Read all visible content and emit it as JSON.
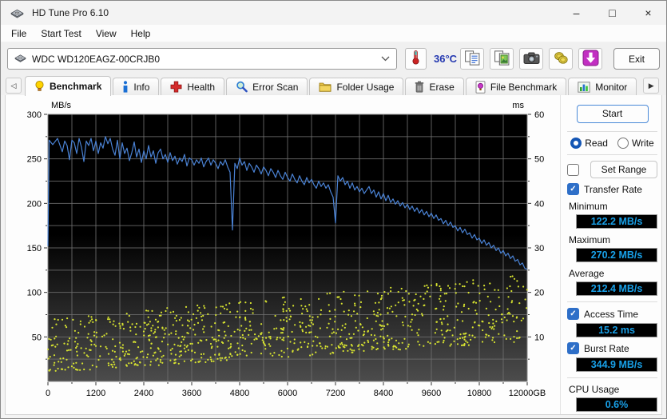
{
  "window": {
    "title": "HD Tune Pro 6.10",
    "controls": {
      "minimize": "–",
      "maximize": "□",
      "close": "×"
    }
  },
  "menu": {
    "items": [
      "File",
      "Start Test",
      "View",
      "Help"
    ]
  },
  "toolbar": {
    "device_selector": {
      "value": "WDC WD120EAGZ-00CRJB0"
    },
    "temperature": "36°C",
    "buttons": [
      {
        "name": "copy-text-icon"
      },
      {
        "name": "copy-image-icon"
      },
      {
        "name": "camera-icon"
      },
      {
        "name": "donate-icon"
      },
      {
        "name": "save-icon"
      }
    ],
    "exit_label": "Exit"
  },
  "tabs": {
    "scroll_left": "◁",
    "scroll_right": "▶",
    "items": [
      {
        "label": "Benchmark",
        "icon": "bulb-icon",
        "active": true
      },
      {
        "label": "Info",
        "icon": "info-icon",
        "active": false
      },
      {
        "label": "Health",
        "icon": "health-icon",
        "active": false
      },
      {
        "label": "Error Scan",
        "icon": "error-scan-icon",
        "active": false
      },
      {
        "label": "Folder Usage",
        "icon": "folder-icon",
        "active": false
      },
      {
        "label": "Erase",
        "icon": "erase-icon",
        "active": false
      },
      {
        "label": "File Benchmark",
        "icon": "file-benchmark-icon",
        "active": false
      },
      {
        "label": "Monitor",
        "icon": "monitor-icon",
        "active": false
      }
    ]
  },
  "side_panel": {
    "start_label": "Start",
    "read_label": "Read",
    "write_label": "Write",
    "mode": "read",
    "set_range_label": "Set Range",
    "set_range_checked": false,
    "transfer_rate_label": "Transfer Rate",
    "transfer_rate_checked": true,
    "minimum_label": "Minimum",
    "minimum_value": "122.2 MB/s",
    "maximum_label": "Maximum",
    "maximum_value": "270.2 MB/s",
    "average_label": "Average",
    "average_value": "212.4 MB/s",
    "access_time_label": "Access Time",
    "access_time_checked": true,
    "access_time_value": "15.2 ms",
    "burst_rate_label": "Burst Rate",
    "burst_rate_checked": true,
    "burst_rate_value": "344.9 MB/s",
    "cpu_usage_label": "CPU Usage",
    "cpu_usage_value": "0.6%"
  },
  "chart_data": {
    "type": "line+scatter",
    "y_left": {
      "label": "MB/s",
      "min": 0,
      "max": 300,
      "tick_step": 50,
      "grid_step": 25
    },
    "y_right": {
      "label": "ms",
      "min": 0,
      "max": 60,
      "tick_step": 10,
      "minor_step": 5
    },
    "x": {
      "min": 0,
      "max": 12000,
      "label_step": 1200,
      "grid_step": 600,
      "last_label_suffix": "GB"
    },
    "grid": true,
    "background": [
      "#000000",
      "#4c4c4c"
    ],
    "grid_color": "#6e6e6e",
    "transfer_rate_series": {
      "name": "Transfer Rate",
      "color": "#4a82d4",
      "axis": "left",
      "points": [
        [
          0,
          152
        ],
        [
          30,
          271
        ],
        [
          120,
          266
        ],
        [
          240,
          273
        ],
        [
          360,
          258
        ],
        [
          420,
          270
        ],
        [
          480,
          265
        ],
        [
          540,
          249
        ],
        [
          600,
          271
        ],
        [
          660,
          268
        ],
        [
          720,
          256
        ],
        [
          780,
          273
        ],
        [
          840,
          263
        ],
        [
          900,
          247
        ],
        [
          960,
          270
        ],
        [
          1020,
          265
        ],
        [
          1080,
          273
        ],
        [
          1140,
          259
        ],
        [
          1200,
          270
        ],
        [
          1260,
          256
        ],
        [
          1320,
          268
        ],
        [
          1380,
          262
        ],
        [
          1440,
          275
        ],
        [
          1500,
          267
        ],
        [
          1560,
          273
        ],
        [
          1620,
          261
        ],
        [
          1680,
          254
        ],
        [
          1740,
          271
        ],
        [
          1800,
          250
        ],
        [
          1860,
          268
        ],
        [
          1920,
          256
        ],
        [
          1980,
          262
        ],
        [
          2040,
          248
        ],
        [
          2100,
          257
        ],
        [
          2160,
          269
        ],
        [
          2220,
          252
        ],
        [
          2280,
          261
        ],
        [
          2340,
          246
        ],
        [
          2400,
          259
        ],
        [
          2460,
          250
        ],
        [
          2520,
          265
        ],
        [
          2580,
          252
        ],
        [
          2640,
          259
        ],
        [
          2700,
          245
        ],
        [
          2760,
          257
        ],
        [
          2820,
          261
        ],
        [
          2880,
          250
        ],
        [
          2940,
          255
        ],
        [
          3000,
          246
        ],
        [
          3060,
          257
        ],
        [
          3120,
          248
        ],
        [
          3180,
          253
        ],
        [
          3240,
          244
        ],
        [
          3300,
          251
        ],
        [
          3360,
          247
        ],
        [
          3420,
          255
        ],
        [
          3480,
          242
        ],
        [
          3540,
          251
        ],
        [
          3600,
          249
        ],
        [
          3660,
          243
        ],
        [
          3720,
          249
        ],
        [
          3780,
          245
        ],
        [
          3840,
          251
        ],
        [
          3900,
          241
        ],
        [
          3960,
          247
        ],
        [
          4020,
          251
        ],
        [
          4080,
          243
        ],
        [
          4140,
          249
        ],
        [
          4200,
          245
        ],
        [
          4260,
          239
        ],
        [
          4320,
          247
        ],
        [
          4380,
          243
        ],
        [
          4440,
          249
        ],
        [
          4500,
          241
        ],
        [
          4560,
          235
        ],
        [
          4620,
          170
        ],
        [
          4680,
          245
        ],
        [
          4740,
          239
        ],
        [
          4800,
          251
        ],
        [
          4860,
          243
        ],
        [
          4920,
          247
        ],
        [
          4980,
          237
        ],
        [
          5040,
          245
        ],
        [
          5100,
          241
        ],
        [
          5160,
          235
        ],
        [
          5220,
          243
        ],
        [
          5280,
          239
        ],
        [
          5340,
          233
        ],
        [
          5400,
          241
        ],
        [
          5460,
          237
        ],
        [
          5520,
          231
        ],
        [
          5580,
          239
        ],
        [
          5640,
          235
        ],
        [
          5700,
          229
        ],
        [
          5760,
          237
        ],
        [
          5820,
          231
        ],
        [
          5880,
          227
        ],
        [
          5940,
          235
        ],
        [
          6000,
          229
        ],
        [
          6060,
          225
        ],
        [
          6120,
          233
        ],
        [
          6180,
          227
        ],
        [
          6240,
          223
        ],
        [
          6300,
          231
        ],
        [
          6360,
          225
        ],
        [
          6420,
          221
        ],
        [
          6480,
          229
        ],
        [
          6540,
          223
        ],
        [
          6600,
          227
        ],
        [
          6660,
          221
        ],
        [
          6720,
          217
        ],
        [
          6780,
          225
        ],
        [
          6840,
          219
        ],
        [
          6900,
          223
        ],
        [
          6960,
          217
        ],
        [
          7020,
          221
        ],
        [
          7080,
          213
        ],
        [
          7140,
          207
        ],
        [
          7200,
          178
        ],
        [
          7260,
          231
        ],
        [
          7320,
          225
        ],
        [
          7380,
          229
        ],
        [
          7440,
          221
        ],
        [
          7500,
          225
        ],
        [
          7560,
          217
        ],
        [
          7620,
          223
        ],
        [
          7680,
          215
        ],
        [
          7740,
          219
        ],
        [
          7800,
          213
        ],
        [
          7860,
          217
        ],
        [
          7920,
          211
        ],
        [
          7980,
          215
        ],
        [
          8040,
          219
        ],
        [
          8100,
          211
        ],
        [
          8160,
          215
        ],
        [
          8220,
          207
        ],
        [
          8280,
          213
        ],
        [
          8340,
          205
        ],
        [
          8400,
          211
        ],
        [
          8460,
          203
        ],
        [
          8520,
          209
        ],
        [
          8580,
          201
        ],
        [
          8640,
          205
        ],
        [
          8700,
          199
        ],
        [
          8760,
          203
        ],
        [
          8820,
          197
        ],
        [
          8880,
          201
        ],
        [
          8940,
          195
        ],
        [
          9000,
          199
        ],
        [
          9060,
          193
        ],
        [
          9120,
          197
        ],
        [
          9180,
          191
        ],
        [
          9240,
          195
        ],
        [
          9300,
          189
        ],
        [
          9360,
          193
        ],
        [
          9420,
          187
        ],
        [
          9480,
          191
        ],
        [
          9540,
          185
        ],
        [
          9600,
          189
        ],
        [
          9660,
          183
        ],
        [
          9720,
          187
        ],
        [
          9780,
          181
        ],
        [
          9840,
          183
        ],
        [
          9900,
          177
        ],
        [
          9960,
          181
        ],
        [
          10020,
          175
        ],
        [
          10080,
          179
        ],
        [
          10140,
          173
        ],
        [
          10200,
          175
        ],
        [
          10260,
          169
        ],
        [
          10320,
          173
        ],
        [
          10380,
          167
        ],
        [
          10440,
          171
        ],
        [
          10500,
          165
        ],
        [
          10560,
          167
        ],
        [
          10620,
          161
        ],
        [
          10680,
          165
        ],
        [
          10740,
          159
        ],
        [
          10800,
          161
        ],
        [
          10860,
          155
        ],
        [
          10920,
          159
        ],
        [
          10980,
          153
        ],
        [
          11040,
          156
        ],
        [
          11100,
          150
        ],
        [
          11160,
          153
        ],
        [
          11220,
          147
        ],
        [
          11280,
          150
        ],
        [
          11340,
          144
        ],
        [
          11400,
          147
        ],
        [
          11460,
          141
        ],
        [
          11520,
          144
        ],
        [
          11580,
          138
        ],
        [
          11640,
          141
        ],
        [
          11700,
          135
        ],
        [
          11760,
          137
        ],
        [
          11820,
          131
        ],
        [
          11880,
          133
        ],
        [
          11940,
          127
        ],
        [
          12000,
          126
        ]
      ]
    },
    "access_time_scatter": {
      "name": "Access Time",
      "color": "#d8e430",
      "axis": "right",
      "count": 950,
      "seed": 1337,
      "band": {
        "base_start": 2,
        "base_end": 9,
        "spread_start": 12,
        "spread_end": 15,
        "max_ms": 26
      }
    }
  }
}
